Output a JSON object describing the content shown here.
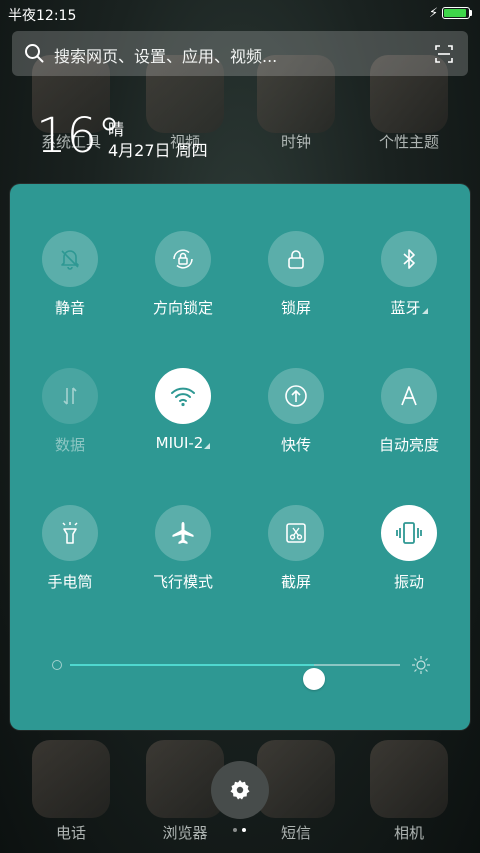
{
  "status_bar": {
    "time": "半夜12:15",
    "battery_level": 0.95
  },
  "search": {
    "placeholder": "搜索网页、设置、应用、视频..."
  },
  "weather": {
    "temp": "16°",
    "condition": "晴",
    "date": "4月27日 周四"
  },
  "background_apps": {
    "top": [
      "系统工具",
      "视频",
      "时钟",
      "个性主题"
    ],
    "dock": [
      "电话",
      "浏览器",
      "短信",
      "相机"
    ]
  },
  "quick_settings": {
    "tiles": [
      {
        "label": "静音",
        "icon": "bell-off-icon",
        "state": "on"
      },
      {
        "label": "方向锁定",
        "icon": "rotation-lock-icon",
        "state": "idle"
      },
      {
        "label": "锁屏",
        "icon": "lock-icon",
        "state": "idle"
      },
      {
        "label": "蓝牙",
        "icon": "bluetooth-icon",
        "state": "idle"
      },
      {
        "label": "数据",
        "icon": "data-arrows-icon",
        "state": "off"
      },
      {
        "label": "MIUI-2",
        "icon": "wifi-icon",
        "state": "on"
      },
      {
        "label": "快传",
        "icon": "transfer-icon",
        "state": "idle"
      },
      {
        "label": "自动亮度",
        "icon": "auto-brightness-icon",
        "state": "idle"
      },
      {
        "label": "手电筒",
        "icon": "flashlight-icon",
        "state": "idle"
      },
      {
        "label": "飞行模式",
        "icon": "airplane-icon",
        "state": "idle"
      },
      {
        "label": "截屏",
        "icon": "screenshot-icon",
        "state": "idle"
      },
      {
        "label": "振动",
        "icon": "vibrate-icon",
        "state": "on"
      }
    ],
    "brightness": 0.74
  },
  "colors": {
    "panel": "#2e9893",
    "slider_fill": "#4fd8cf",
    "battery": "#3fd64a"
  }
}
